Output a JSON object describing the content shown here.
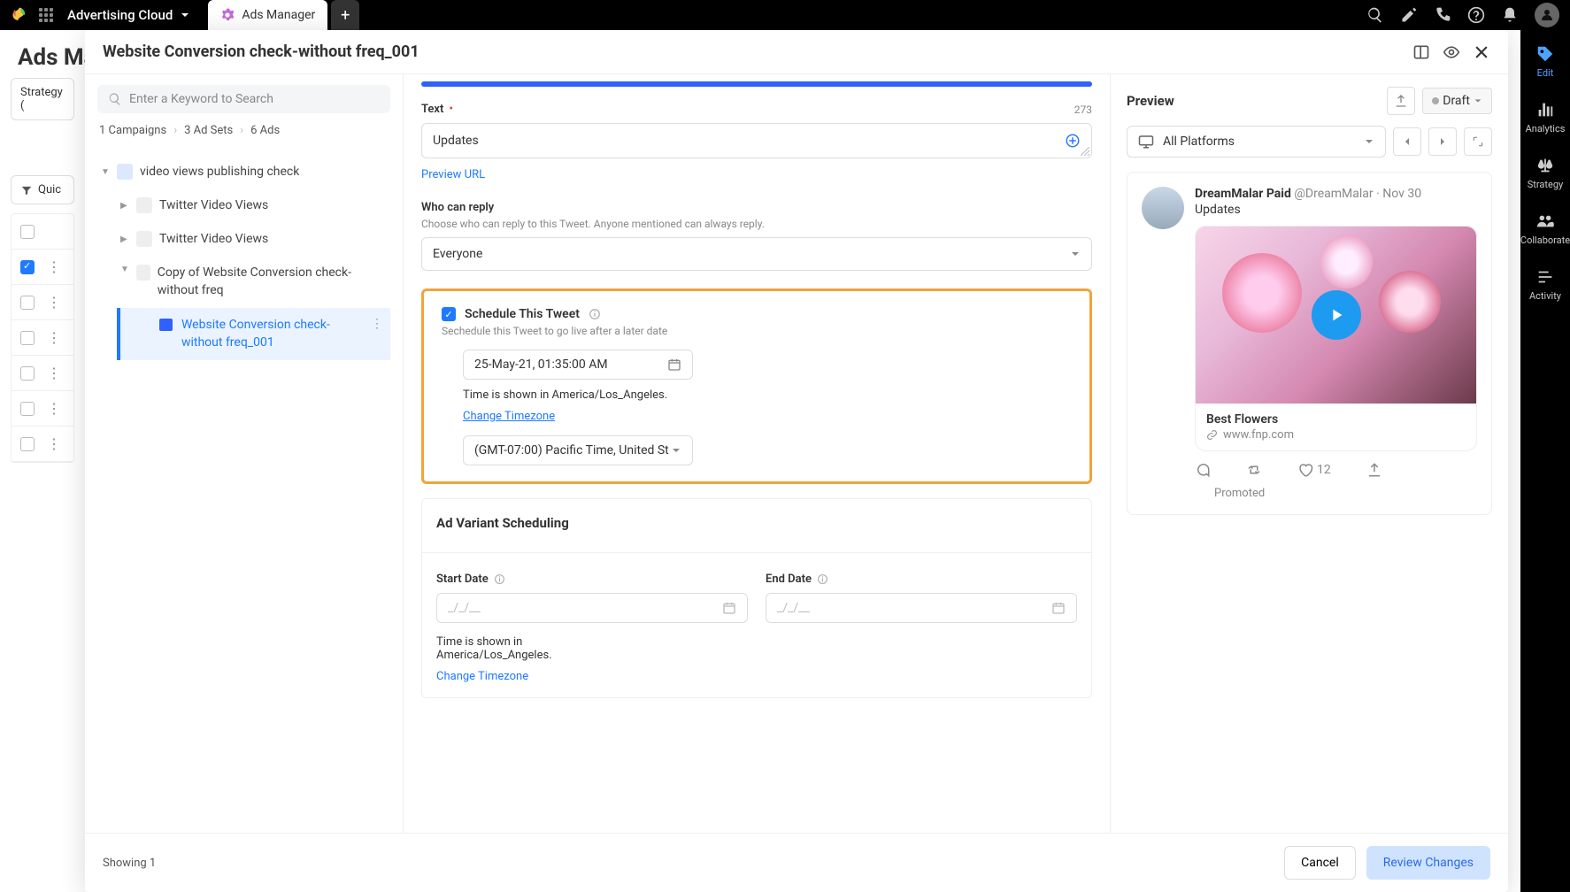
{
  "topbar": {
    "workspace": "Advertising Cloud",
    "tab_label": "Ads Manager"
  },
  "page": {
    "title": "Ads Mana"
  },
  "left_strip": {
    "strategy": "Strategy (",
    "quick": "Quic"
  },
  "modal": {
    "title": "Website Conversion check-without freq_001",
    "search_placeholder": "Enter a Keyword to Search",
    "breadcrumbs": {
      "campaigns": "1 Campaigns",
      "adsets": "3 Ad Sets",
      "ads": "6 Ads"
    },
    "tree": {
      "root": "video views publishing check",
      "child1": "Twitter Video Views",
      "child2": "Twitter Video Views",
      "child3": "Copy of Website Conversion check-without freq",
      "leaf": "Website Conversion check-without freq_001"
    },
    "text_section": {
      "label": "Text",
      "char_count": "273",
      "value": "Updates",
      "preview_url": "Preview URL"
    },
    "reply_section": {
      "label": "Who can reply",
      "help": "Choose who can reply to this Tweet. Anyone mentioned can always reply.",
      "value": "Everyone"
    },
    "schedule": {
      "label": "Schedule This Tweet",
      "help": "Sechedule this Tweet to go live after a later date",
      "datetime": "25-May-21, 01:35:00 AM",
      "tz_note": "Time is shown in America/Los_Angeles.",
      "change_tz": "Change Timezone",
      "tz_value": "(GMT-07:00) Pacific Time, United St"
    },
    "variant": {
      "title": "Ad Variant Scheduling",
      "start_label": "Start Date",
      "end_label": "End Date",
      "placeholder": "_/_/__",
      "tz_note": "Time is shown in America/Los_Angeles.",
      "change_tz": "Change Timezone"
    }
  },
  "preview": {
    "title": "Preview",
    "status": "Draft",
    "platforms": "All Platforms",
    "tweet": {
      "name": "DreamMalar Paid",
      "handle": "@DreamMalar",
      "date": "Nov 30",
      "text": "Updates",
      "card_title": "Best Flowers",
      "card_url": "www.fnp.com",
      "likes": "12",
      "promoted": "Promoted"
    }
  },
  "footer": {
    "showing": "Showing 1",
    "cancel": "Cancel",
    "review": "Review Changes"
  },
  "rail": {
    "edit": "Edit",
    "analytics": "Analytics",
    "strategy": "Strategy",
    "collaborate": "Collaborate",
    "activity": "Activity"
  }
}
